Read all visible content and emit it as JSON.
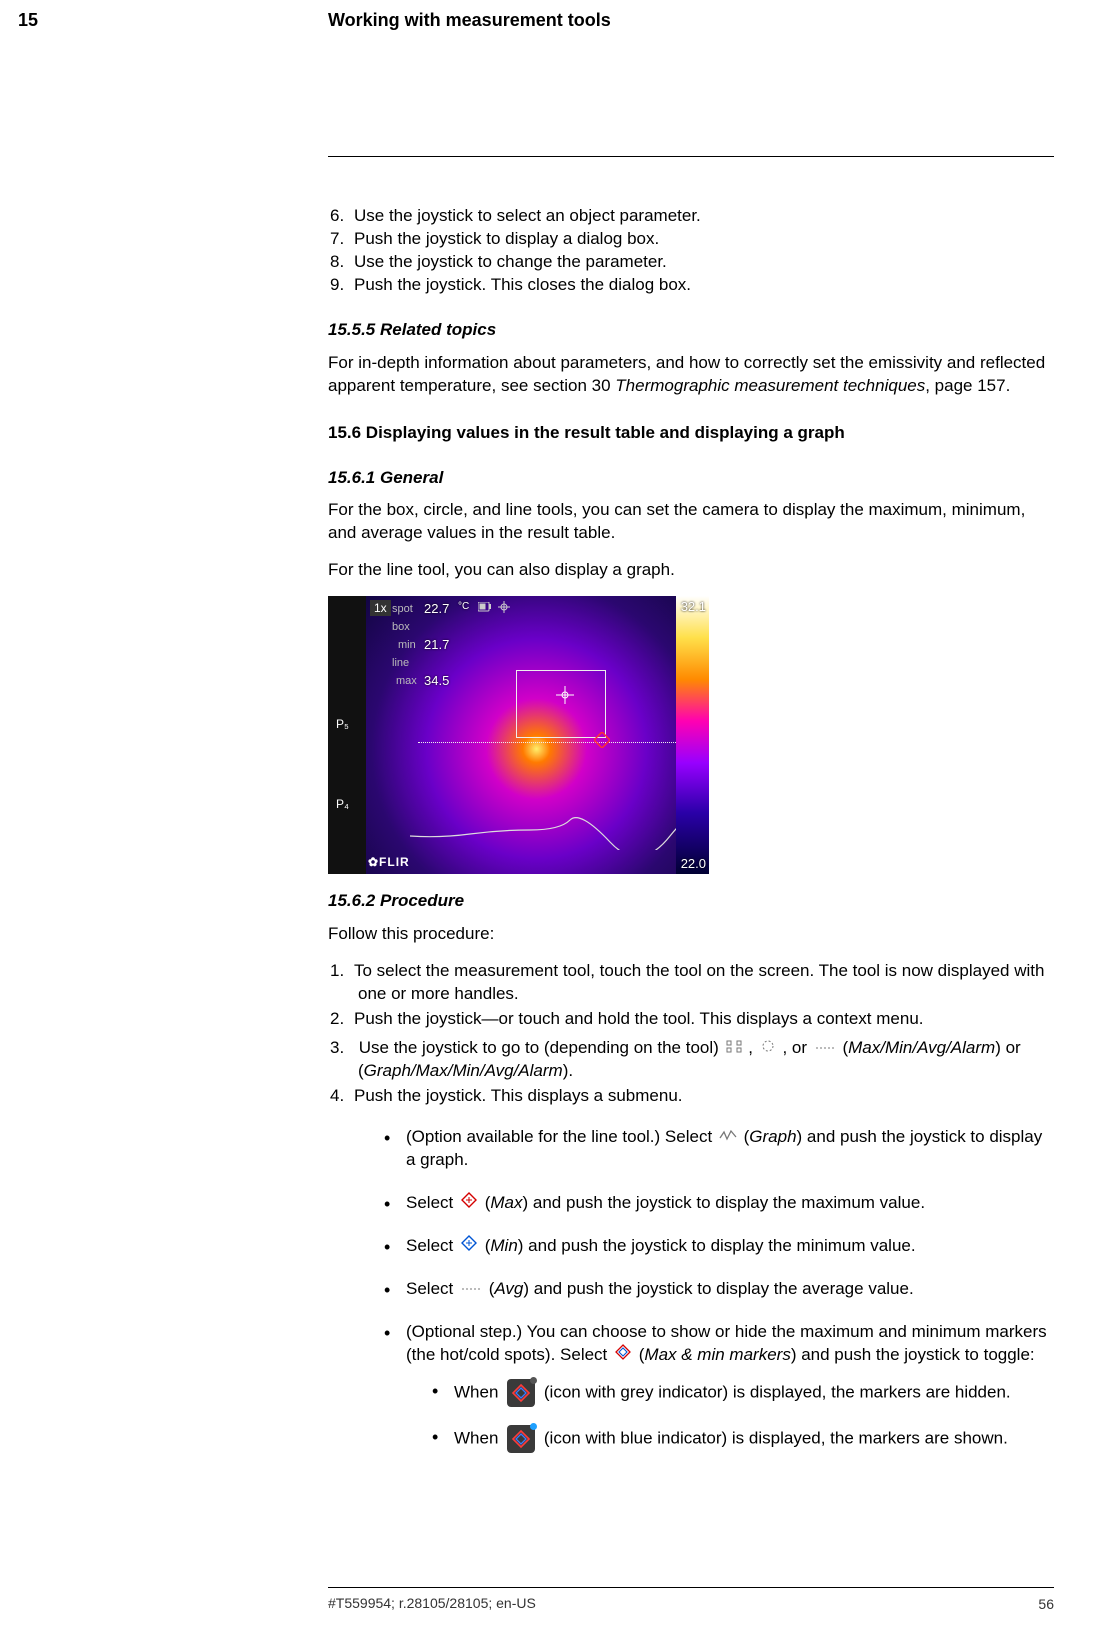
{
  "header": {
    "chapter_no": "15",
    "chapter_title": "Working with measurement tools"
  },
  "steps_6_9": [
    "Use the joystick to select an object parameter.",
    "Push the joystick to display a dialog box.",
    "Use the joystick to change the parameter.",
    "Push the joystick. This closes the dialog box."
  ],
  "s1555": {
    "heading": "15.5.5    Related topics",
    "para_a": "For in-depth information about parameters, and how to correctly set the emissivity and reflected apparent temperature, see section 30 ",
    "para_a_ital": "Thermographic measurement techniques",
    "para_a_tail": ", page 157."
  },
  "s156": {
    "heading": "15.6    Displaying values in the result table and displaying a graph"
  },
  "s1561": {
    "heading": "15.6.1    General",
    "p1": "For the box, circle, and line tools, you can set the camera to display the maximum, minimum, and average values in the result table.",
    "p2": "For the line tool, you can also display a graph."
  },
  "thermal": {
    "zoom": "1x",
    "spot_label": "spot",
    "spot_val": "22.7",
    "unit": "°C",
    "box_label": "box",
    "min_label": "min",
    "min_val": "21.7",
    "line_label": "line",
    "max_label": "max",
    "max_val": "34.5",
    "scale_hi": "32.1",
    "scale_lo": "22.0",
    "logo": "✿FLIR",
    "p5": "P₅",
    "p4": "P₄"
  },
  "s1562": {
    "heading": "15.6.2    Procedure",
    "intro": "Follow this procedure:",
    "step1": "To select the measurement tool, touch the tool on the screen. The tool is now displayed with one or more handles.",
    "step2": "Push the joystick—or touch and hold the tool. This displays a context menu.",
    "step3_a": "Use the joystick to go to (depending on the tool) ",
    "step3_b": ", ",
    "step3_c": ", or ",
    "step3_d": " (",
    "step3_ital1": "Max/Min/Avg/Alarm",
    "step3_e": ") or (",
    "step3_ital2": "Graph/Max/Min/Avg/Alarm",
    "step3_f": ").",
    "step4": "Push the joystick. This displays a submenu.",
    "b_graph_a": "(Option available for the line tool.) Select ",
    "b_graph_b": " (",
    "b_graph_ital": "Graph",
    "b_graph_c": ") and push the joystick to display a graph.",
    "b_max_a": "Select ",
    "b_max_b": " (",
    "b_max_ital": "Max",
    "b_max_c": ") and push the joystick to display the maximum value.",
    "b_min_a": "Select ",
    "b_min_b": " (",
    "b_min_ital": "Min",
    "b_min_c": ") and push the joystick to display the minimum value.",
    "b_avg_a": "Select ",
    "b_avg_b": " (",
    "b_avg_ital": "Avg",
    "b_avg_c": ") and push the joystick to display the average value.",
    "b_mm_a": "(Optional step.) You can choose to show or hide the maximum and minimum markers (the hot/cold spots). Select ",
    "b_mm_b": " (",
    "b_mm_ital": "Max & min markers",
    "b_mm_c": ") and push the joystick to toggle:",
    "sub_grey_a": "When ",
    "sub_grey_b": " (icon with grey indicator) is displayed, the markers are hidden.",
    "sub_blue_a": "When ",
    "sub_blue_b": " (icon with blue indicator) is displayed, the markers are shown."
  },
  "footer": {
    "code": "#T559954; r.28105/28105; en-US",
    "page": "56"
  }
}
